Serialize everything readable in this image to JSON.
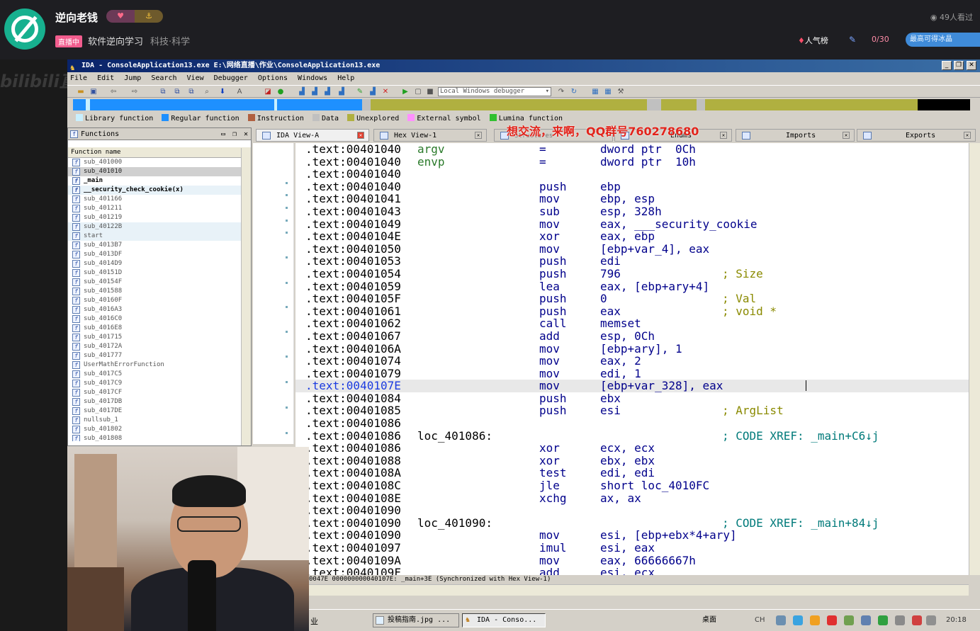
{
  "stream": {
    "streamer_name": "逆向老钱",
    "badge_left": "♥",
    "badge_right": "⚓",
    "live_tag": "直播中",
    "area": "软件逆向学习",
    "category": "科技·科学",
    "viewers": "49人看过",
    "rank_label": "人气榜",
    "fans_count": "0/30",
    "vip_text": "最高可得冰晶",
    "watermark": "bilibili直",
    "overlay_banner": "想交流，来啊，QQ群号760278680"
  },
  "ida": {
    "title": "IDA - ConsoleApplication13.exe E:\\网络直播\\作业\\ConsoleApplication13.exe",
    "menu": [
      "File",
      "Edit",
      "Jump",
      "Search",
      "View",
      "Debugger",
      "Options",
      "Windows",
      "Help"
    ],
    "debugger_select": "Local Windows debugger",
    "legend": [
      {
        "label": "Library function",
        "color": "#c8f0ff"
      },
      {
        "label": "Regular function",
        "color": "#1e90ff"
      },
      {
        "label": "Instruction",
        "color": "#b06040"
      },
      {
        "label": "Data",
        "color": "#c0c0c0"
      },
      {
        "label": "Unexplored",
        "color": "#b0b040"
      },
      {
        "label": "External symbol",
        "color": "#ff90ff"
      },
      {
        "label": "Lumina function",
        "color": "#30c030"
      }
    ],
    "functions_title": "Functions",
    "functions_column": "Function name",
    "functions": [
      {
        "name": "sub_401000",
        "style": "normal"
      },
      {
        "name": "sub_401010",
        "style": "sel"
      },
      {
        "name": "_main",
        "style": "bold"
      },
      {
        "name": "__security_check_cookie(x)",
        "style": "boldhl"
      },
      {
        "name": "sub_401166",
        "style": "normal"
      },
      {
        "name": "sub_401211",
        "style": "normal"
      },
      {
        "name": "sub_401219",
        "style": "normal"
      },
      {
        "name": "sub_40122B",
        "style": "hl"
      },
      {
        "name": "start",
        "style": "hl"
      },
      {
        "name": "sub_4013B7",
        "style": "normal"
      },
      {
        "name": "sub_4013DF",
        "style": "normal"
      },
      {
        "name": "sub_4014D9",
        "style": "normal"
      },
      {
        "name": "sub_40151D",
        "style": "normal"
      },
      {
        "name": "sub_40154F",
        "style": "normal"
      },
      {
        "name": "sub_401588",
        "style": "normal"
      },
      {
        "name": "sub_40160F",
        "style": "normal"
      },
      {
        "name": "sub_4016A3",
        "style": "normal"
      },
      {
        "name": "sub_4016C0",
        "style": "normal"
      },
      {
        "name": "sub_4016E8",
        "style": "normal"
      },
      {
        "name": "sub_401715",
        "style": "normal"
      },
      {
        "name": "sub_40172A",
        "style": "normal"
      },
      {
        "name": "sub_401777",
        "style": "normal"
      },
      {
        "name": "UserMathErrorFunction",
        "style": "normal"
      },
      {
        "name": "sub_4017C5",
        "style": "normal"
      },
      {
        "name": "sub_4017C9",
        "style": "normal"
      },
      {
        "name": "sub_4017CF",
        "style": "normal"
      },
      {
        "name": "sub_4017DB",
        "style": "normal"
      },
      {
        "name": "sub_4017DE",
        "style": "normal"
      },
      {
        "name": "nullsub_1",
        "style": "normal"
      },
      {
        "name": "sub_401802",
        "style": "normal"
      },
      {
        "name": "sub_401808",
        "style": "normal"
      }
    ],
    "tabs": [
      {
        "label": "IDA View-A"
      },
      {
        "label": "Hex View-1"
      },
      {
        "label": "Structures"
      },
      {
        "label": "Enums"
      },
      {
        "label": "Imports"
      },
      {
        "label": "Exports"
      }
    ],
    "disasm": [
      {
        "addr": ".text:00401040",
        "label": "argv",
        "lblclass": "var",
        "mn": "=",
        "op": "dword ptr  0Ch",
        "cm": ""
      },
      {
        "addr": ".text:00401040",
        "label": "envp",
        "lblclass": "var",
        "mn": "=",
        "op": "dword ptr  10h",
        "cm": ""
      },
      {
        "addr": ".text:00401040",
        "label": "",
        "mn": "",
        "op": "",
        "cm": ""
      },
      {
        "addr": ".text:00401040",
        "label": "",
        "mn": "push",
        "op": "ebp",
        "cm": ""
      },
      {
        "addr": ".text:00401041",
        "label": "",
        "mn": "mov",
        "op": "ebp, esp",
        "cm": ""
      },
      {
        "addr": ".text:00401043",
        "label": "",
        "mn": "sub",
        "op": "esp, 328h",
        "cm": ""
      },
      {
        "addr": ".text:00401049",
        "label": "",
        "mn": "mov",
        "op": "eax, ___security_cookie",
        "cm": ""
      },
      {
        "addr": ".text:0040104E",
        "label": "",
        "mn": "xor",
        "op": "eax, ebp",
        "cm": ""
      },
      {
        "addr": ".text:00401050",
        "label": "",
        "mn": "mov",
        "op": "[ebp+var_4], eax",
        "cm": ""
      },
      {
        "addr": ".text:00401053",
        "label": "",
        "mn": "push",
        "op": "edi",
        "cm": ""
      },
      {
        "addr": ".text:00401054",
        "label": "",
        "mn": "push",
        "op": "796",
        "cm": "; Size"
      },
      {
        "addr": ".text:00401059",
        "label": "",
        "mn": "lea",
        "op": "eax, [ebp+ary+4]",
        "cm": ""
      },
      {
        "addr": ".text:0040105F",
        "label": "",
        "mn": "push",
        "op": "0",
        "cm": "; Val"
      },
      {
        "addr": ".text:00401061",
        "label": "",
        "mn": "push",
        "op": "eax",
        "cm": "; void *"
      },
      {
        "addr": ".text:00401062",
        "label": "",
        "mn": "call",
        "op": "memset",
        "cm": ""
      },
      {
        "addr": ".text:00401067",
        "label": "",
        "mn": "add",
        "op": "esp, 0Ch",
        "cm": ""
      },
      {
        "addr": ".text:0040106A",
        "label": "",
        "mn": "mov",
        "op": "[ebp+ary], 1",
        "cm": ""
      },
      {
        "addr": ".text:00401074",
        "label": "",
        "mn": "mov",
        "op": "eax, 2",
        "cm": ""
      },
      {
        "addr": ".text:00401079",
        "label": "",
        "mn": "mov",
        "op": "edi, 1",
        "cm": ""
      },
      {
        "addr": ".text:0040107E",
        "label": "",
        "mn": "mov",
        "op": "[ebp+var_328], eax",
        "cm": "",
        "current": true
      },
      {
        "addr": ".text:00401084",
        "label": "",
        "mn": "push",
        "op": "ebx",
        "cm": ""
      },
      {
        "addr": ".text:00401085",
        "label": "",
        "mn": "push",
        "op": "esi",
        "cm": "; ArgList"
      },
      {
        "addr": ".text:00401086",
        "label": "",
        "mn": "",
        "op": "",
        "cm": ""
      },
      {
        "addr": ".text:00401086",
        "label": "loc_401086:",
        "mn": "",
        "op": "",
        "cm": "; CODE XREF: _main+C6↓j",
        "xref": true
      },
      {
        "addr": ".text:00401086",
        "label": "",
        "mn": "xor",
        "op": "ecx, ecx",
        "cm": ""
      },
      {
        "addr": ".text:00401088",
        "label": "",
        "mn": "xor",
        "op": "ebx, ebx",
        "cm": ""
      },
      {
        "addr": ".text:0040108A",
        "label": "",
        "mn": "test",
        "op": "edi, edi",
        "cm": ""
      },
      {
        "addr": ".text:0040108C",
        "label": "",
        "mn": "jle",
        "op": "short loc_4010FC",
        "cm": ""
      },
      {
        "addr": ".text:0040108E",
        "label": "",
        "mn": "xchg",
        "op": "ax, ax",
        "cm": ""
      },
      {
        "addr": ".text:00401090",
        "label": "",
        "mn": "",
        "op": "",
        "cm": ""
      },
      {
        "addr": ".text:00401090",
        "label": "loc_401090:",
        "mn": "",
        "op": "",
        "cm": "; CODE XREF: _main+84↓j",
        "xref": true
      },
      {
        "addr": ".text:00401090",
        "label": "",
        "mn": "mov",
        "op": "esi, [ebp+ebx*4+ary]",
        "cm": ""
      },
      {
        "addr": ".text:00401097",
        "label": "",
        "mn": "imul",
        "op": "esi, eax",
        "cm": ""
      },
      {
        "addr": ".text:0040109A",
        "label": "",
        "mn": "mov",
        "op": "eax, 66666667h",
        "cm": ""
      },
      {
        "addr": ".text:0040109F",
        "label": "",
        "mn": "add",
        "op": "esi, ecx",
        "cm": ""
      }
    ],
    "status_line": "0047E 000000000040107E: _main+3E (Synchronized with Hex View-1)"
  },
  "taskbar": {
    "label_left": "业",
    "tasks": [
      "投稿指南.jpg ...",
      "IDA - Conso..."
    ],
    "tray_text": "桌面",
    "lang": "CH",
    "clock": "20:18"
  }
}
